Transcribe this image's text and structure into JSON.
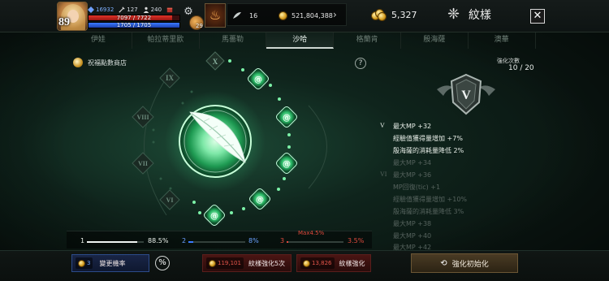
{
  "player": {
    "level": "89",
    "stat_a": "16932",
    "stat_b": "127",
    "stat_c": "240",
    "hp_text": "7097 / 7722",
    "hp_fraction": 0.919,
    "mp_text": "1705 / 1705",
    "mp_fraction": 1.0,
    "pet_count": "29"
  },
  "currencies": {
    "feather_count": "16",
    "silver": "521,804,388",
    "gold": "5,327"
  },
  "header": {
    "title": "紋樣",
    "close_icon": "close-icon"
  },
  "tabs": [
    {
      "label": "伊娃",
      "active": false
    },
    {
      "label": "帕拉蒂里歐",
      "active": false
    },
    {
      "label": "馬薔勒",
      "active": false
    },
    {
      "label": "沙哈",
      "active": true
    },
    {
      "label": "格蘭肯",
      "active": false
    },
    {
      "label": "殷海薩",
      "active": false
    },
    {
      "label": "澳華",
      "active": false
    }
  ],
  "shop": {
    "label": "祝福點數商店"
  },
  "help": {
    "label": "?"
  },
  "wheel": {
    "roman_nodes": [
      "IX",
      "VIII",
      "VII",
      "VI"
    ],
    "top_node": "X",
    "active_nodes": 6
  },
  "progress": {
    "seg1_num": "1",
    "seg1_pct": "88.5%",
    "seg1_fill": 0.885,
    "seg2_num": "2",
    "seg2_pct": "8%",
    "seg2_fill": 0.08,
    "seg3_num": "3",
    "seg3_pct": "3.5%",
    "seg3_fill": 0.035,
    "max_label": "Max4.5%"
  },
  "enhance": {
    "label": "強化次數",
    "value": "10 / 20",
    "crest_numeral": "V"
  },
  "effects": [
    {
      "roman": "V",
      "active": true,
      "lines": [
        "最大MP +32",
        "經驗值獲得量增加 +7%",
        "殷海薩的消耗量降低 2%"
      ]
    },
    {
      "roman": "VI",
      "active": false,
      "lines": [
        "最大MP +34",
        "最大MP +36",
        "MP回復(tic) +1",
        "經驗值獲得量增加 +10%",
        "殷海薩的消耗量降低 3%",
        "最大MP +38",
        "最大MP +40",
        "最大MP +42"
      ]
    }
  ],
  "bottom": {
    "change_cost": "3",
    "change_label": "變更機率",
    "pct_label": "%",
    "enhance5_cost": "119,101",
    "enhance5_label": "紋樣強化5次",
    "enhance_cost": "13,826",
    "enhance_label": "紋樣強化",
    "reset_label": "強化初始化"
  },
  "colors": {
    "accent_green": "#4fe08a",
    "active_text": "#e9efe9",
    "inactive_text": "#55625d",
    "danger": "#e04b3e",
    "mp_blue": "#3b7bff"
  }
}
